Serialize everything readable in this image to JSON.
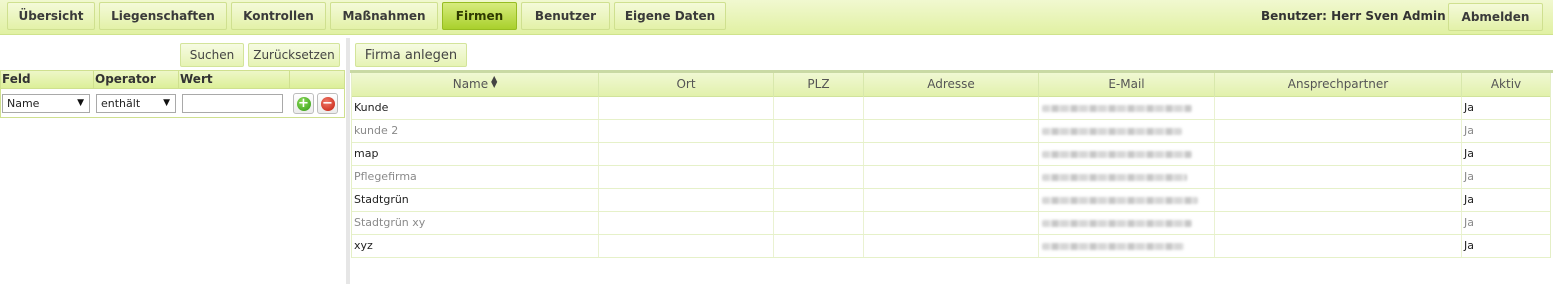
{
  "nav": {
    "tabs": [
      {
        "label": "Übersicht"
      },
      {
        "label": "Liegenschaften"
      },
      {
        "label": "Kontrollen"
      },
      {
        "label": "Maßnahmen"
      },
      {
        "label": "Firmen"
      },
      {
        "label": "Benutzer"
      },
      {
        "label": "Eigene Daten"
      }
    ],
    "active_tab": "Firmen",
    "user_label": "Benutzer: Herr Sven Admin",
    "logout_label": "Abmelden"
  },
  "filter": {
    "search_label": "Suchen",
    "reset_label": "Zurücksetzen",
    "headers": {
      "field": "Feld",
      "operator": "Operator",
      "value": "Wert"
    },
    "field_value": "Name",
    "operator_value": "enthält",
    "value_input": "",
    "add_icon": "plus-circle-icon",
    "remove_icon": "minus-circle-icon"
  },
  "grid": {
    "create_label": "Firma anlegen",
    "columns": {
      "name": "Name",
      "ort": "Ort",
      "plz": "PLZ",
      "adresse": "Adresse",
      "email": "E-Mail",
      "ansprechpartner": "Ansprechpartner",
      "aktiv": "Aktiv"
    },
    "sort_icon": "sort-triangles-icon",
    "rows": [
      {
        "name": "Kunde",
        "aktiv": "Ja"
      },
      {
        "name": "kunde 2",
        "aktiv": "Ja"
      },
      {
        "name": "map",
        "aktiv": "Ja"
      },
      {
        "name": "Pflegefirma",
        "aktiv": "Ja"
      },
      {
        "name": "Stadtgrün",
        "aktiv": "Ja"
      },
      {
        "name": "Stadtgrün xy",
        "aktiv": "Ja"
      },
      {
        "name": "xyz",
        "aktiv": "Ja"
      }
    ]
  },
  "colors": {
    "accent": "#a9d02c",
    "bar_light": "#f1f8d0",
    "bar_dark": "#e1f1a3"
  }
}
